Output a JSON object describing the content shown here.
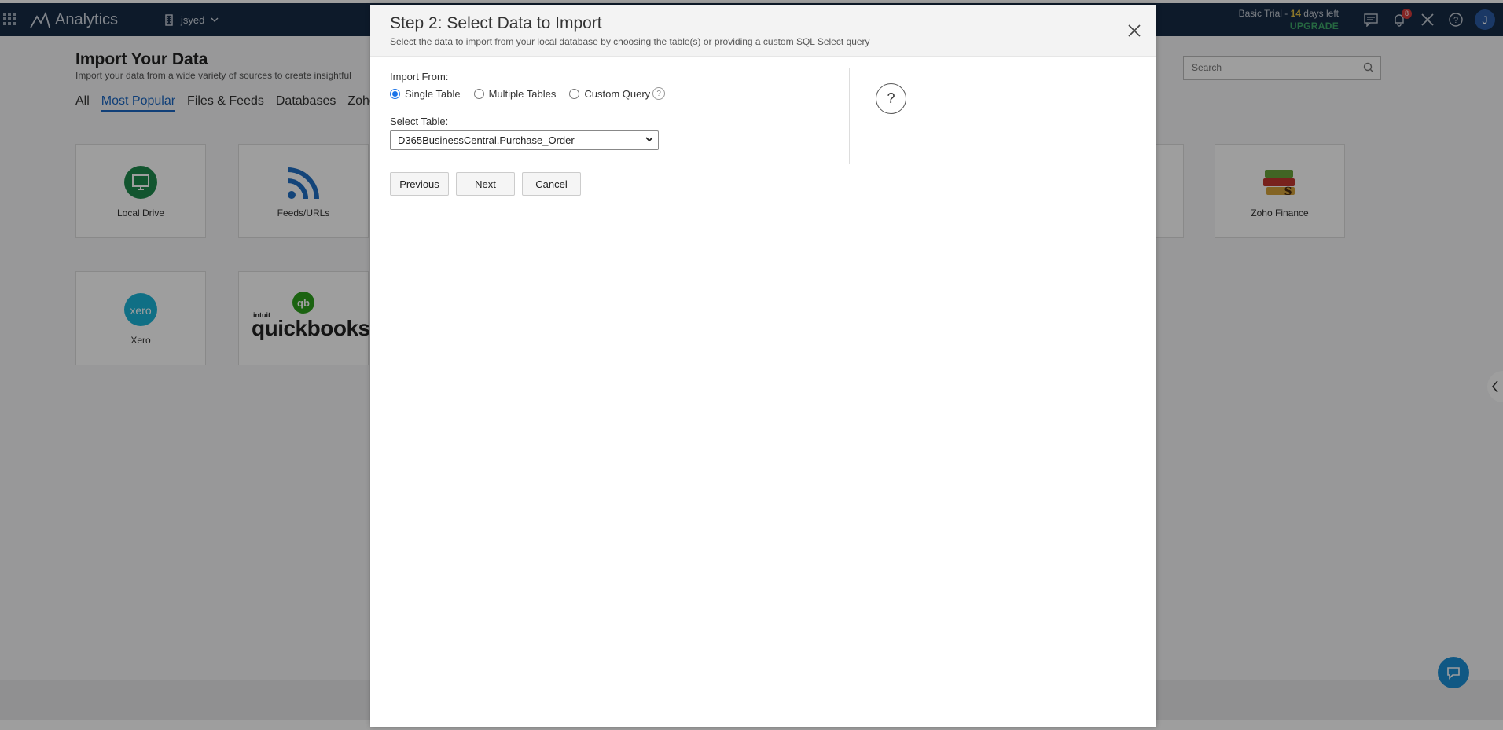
{
  "topbar": {
    "app_name": "Analytics",
    "workspace": "jsyed",
    "trial_prefix": "Basic Trial - ",
    "trial_days": "14",
    "trial_suffix": " days left",
    "upgrade": "UPGRADE",
    "notification_count": "8",
    "avatar_initial": "J"
  },
  "background": {
    "page_title": "Import Your Data",
    "page_subtitle": "Import your data from a wide variety of sources to create insightful",
    "tabs": [
      "All",
      "Most Popular",
      "Files & Feeds",
      "Databases",
      "Zoho"
    ],
    "active_tab": "Most Popular",
    "search_placeholder": "Search",
    "tiles": {
      "local_drive": "Local Drive",
      "feeds": "Feeds/URLs",
      "zoho_finance": "Zoho Finance",
      "xero": "Xero",
      "xero_logo": "xero",
      "quickbooks": "quickbooks",
      "quickbooks_intuit": "intuit"
    }
  },
  "modal": {
    "title": "Step 2: Select Data to Import",
    "subtitle": "Select the data to import from your local database by choosing the table(s) or providing a custom SQL Select query",
    "import_from_label": "Import From:",
    "options": [
      "Single Table",
      "Multiple Tables",
      "Custom Query"
    ],
    "selected_option": "Single Table",
    "select_table_label": "Select Table:",
    "selected_table": "D365BusinessCentral.Purchase_Order",
    "buttons": {
      "previous": "Previous",
      "next": "Next",
      "cancel": "Cancel"
    },
    "help_symbol": "?"
  },
  "colors": {
    "topbar": "#162b44",
    "accent": "#1a73e8",
    "upgrade": "#3ea86a",
    "trial_days": "#e2c044"
  }
}
